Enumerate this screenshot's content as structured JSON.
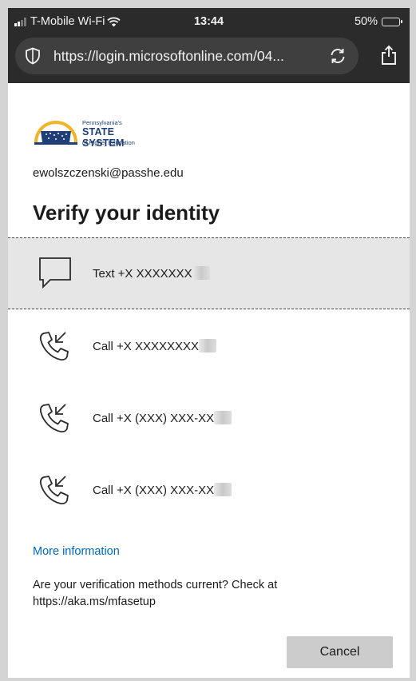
{
  "status_bar": {
    "carrier": "T-Mobile Wi-Fi",
    "time": "13:44",
    "battery": "50%",
    "battery_level": 0.5,
    "icons": [
      "signal-icon",
      "wifi-icon",
      "battery-icon"
    ]
  },
  "browser": {
    "url": "https://login.microsoftonline.com/04...",
    "icons": [
      "shield-icon",
      "reload-icon",
      "share-icon"
    ]
  },
  "logo": {
    "line1": "Pennsylvania's",
    "line2": "STATE SYSTEM",
    "line3": "of Higher Education"
  },
  "account": {
    "email": "ewolszczenski@passhe.edu"
  },
  "page": {
    "title": "Verify your identity"
  },
  "options": [
    {
      "label": "Text +X XXXXXXX",
      "icon": "message-icon",
      "selected": true
    },
    {
      "label": "Call +X XXXXXXXX",
      "icon": "phone-call-icon",
      "selected": false
    },
    {
      "label": "Call +X (XXX) XXX-XX",
      "icon": "phone-call-icon",
      "selected": false
    },
    {
      "label": "Call +X (XXX) XXX-XX",
      "icon": "phone-call-icon",
      "selected": false
    }
  ],
  "links": {
    "more_info": "More information"
  },
  "note": {
    "text": "Are your verification methods current? Check at https://aka.ms/mfasetup"
  },
  "buttons": {
    "cancel": "Cancel"
  },
  "colors": {
    "link": "#0067b8",
    "selected_bg": "#e6e6e6",
    "chrome_bg": "#2b2b2b",
    "button_bg": "#cccccc"
  }
}
